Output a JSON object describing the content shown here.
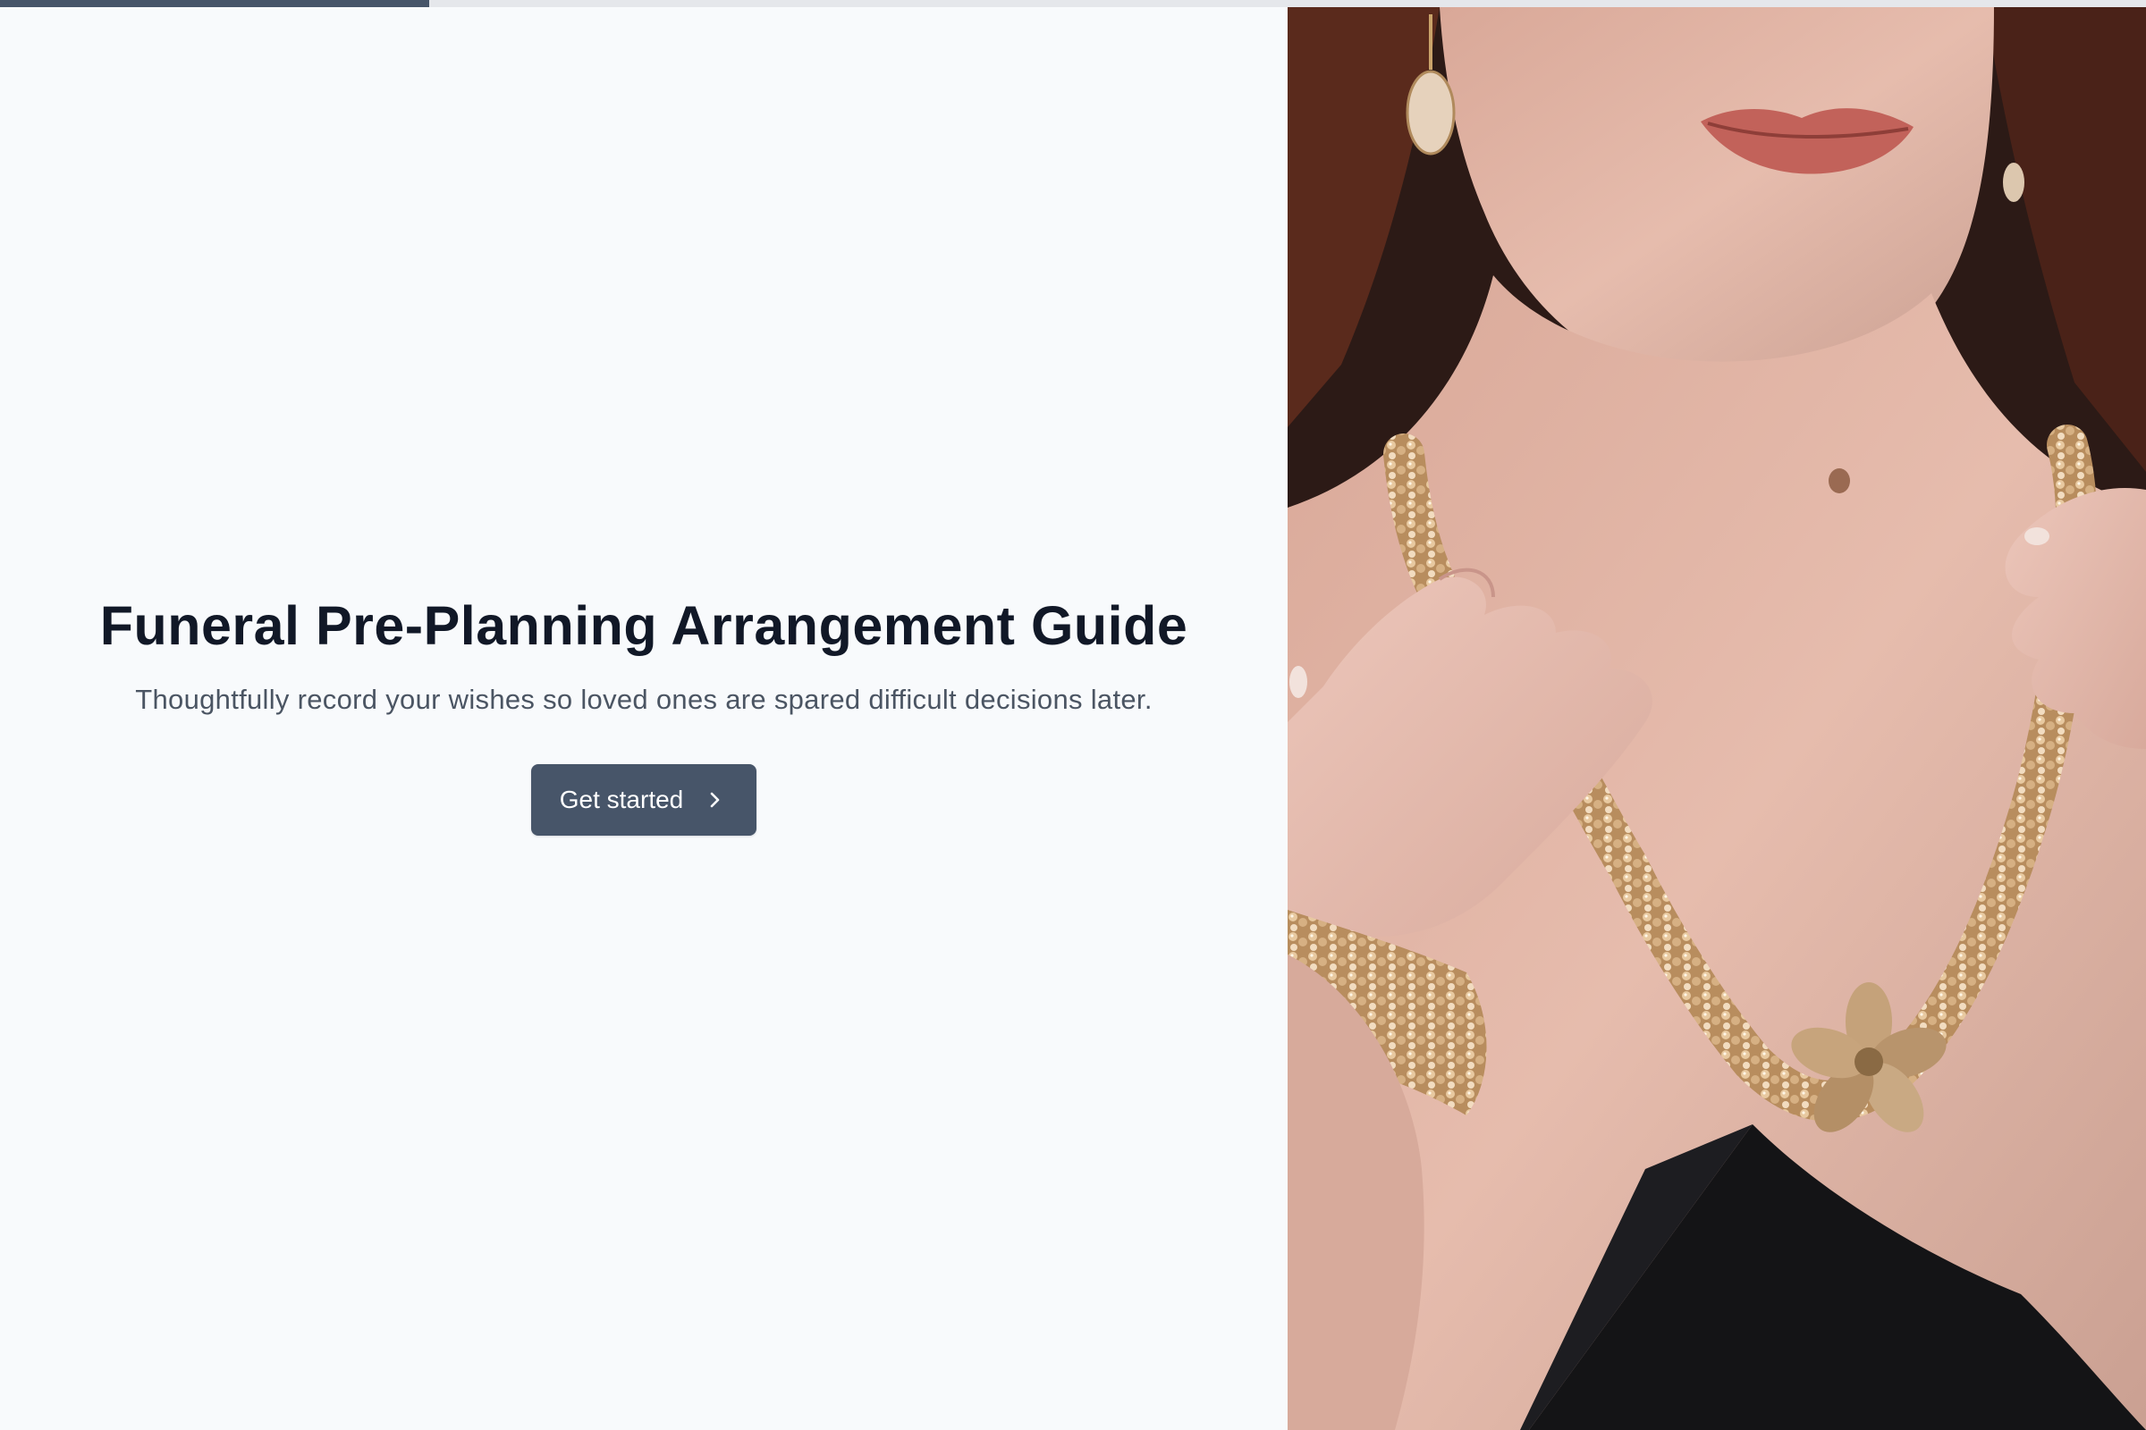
{
  "progress": {
    "fraction": 0.2
  },
  "hero": {
    "title": "Funeral Pre-Planning Arrangement Guide",
    "subtitle": "Thoughtfully record your wishes so loved ones are spared difficult decisions later.",
    "cta_label": "Get started",
    "cta_icon": "chevron-right-icon"
  },
  "photo": {
    "subject": "woman wearing crystal bead necklace and bracelet",
    "colors": {
      "background": "#3a2420",
      "skin": "#e2b8a8",
      "hair": "#5a2a1c",
      "lips": "#c2625a",
      "beads": "#cfa77c",
      "dress": "#141416"
    }
  },
  "theme": {
    "accent": "#475569",
    "page_bg": "#f8fafc",
    "title_color": "#111827",
    "subtitle_color": "#4b5563"
  }
}
